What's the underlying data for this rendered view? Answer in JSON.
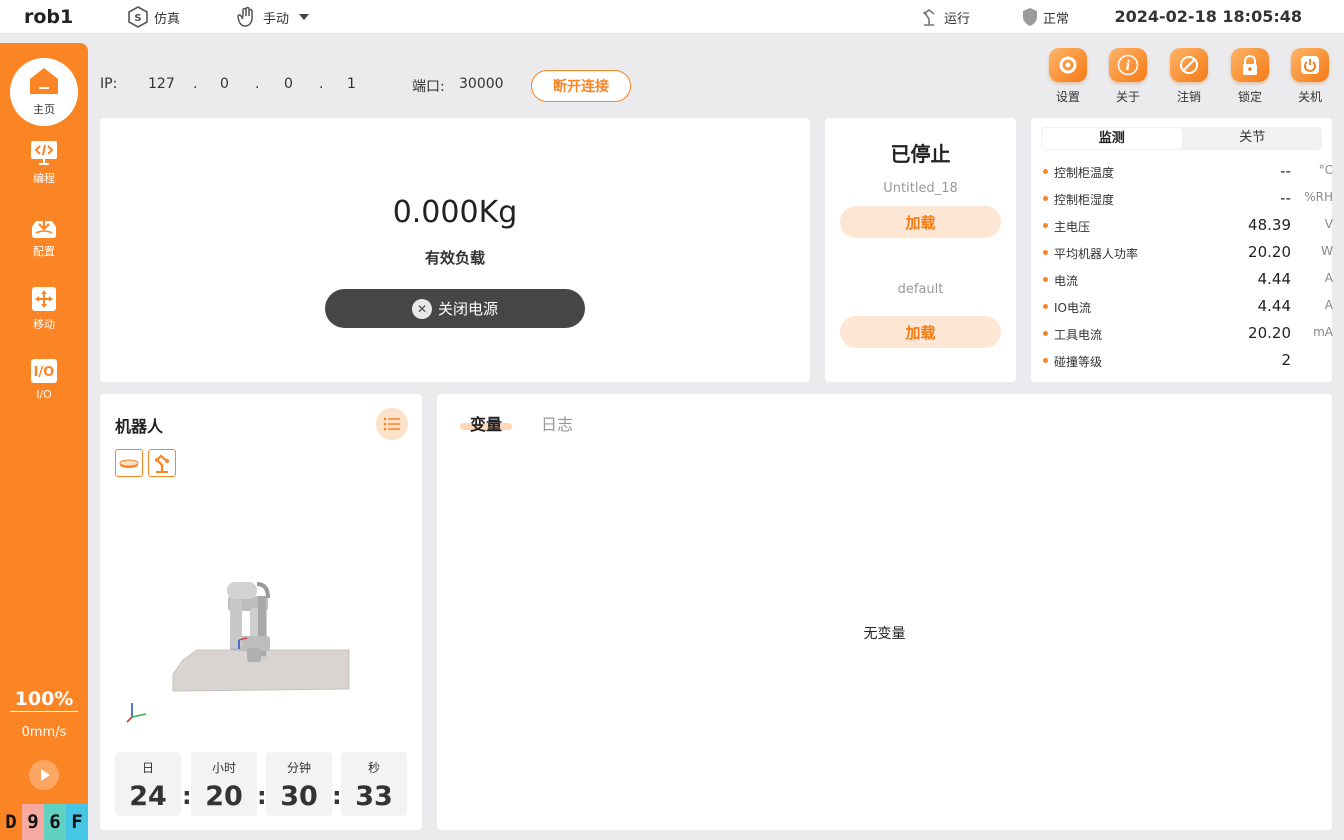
{
  "topbar": {
    "app_name": "rob1",
    "sim_mode": "仿真",
    "hand_mode": "手动",
    "run_state": "运行",
    "health": "正常",
    "datetime": "2024-02-18 18:05:48"
  },
  "sidebar": {
    "home": "主页",
    "items": [
      {
        "label": "编程",
        "icon": "code-icon"
      },
      {
        "label": "配置",
        "icon": "download-icon"
      },
      {
        "label": "移动",
        "icon": "move-icon"
      },
      {
        "label": "I/O",
        "icon": "io-icon"
      }
    ],
    "speed_percent": "100%",
    "speed_value": "0mm/s",
    "badges": [
      {
        "text": "D",
        "color": "#fb8425"
      },
      {
        "text": "9",
        "color": "#f6a9a0"
      },
      {
        "text": "6",
        "color": "#5fd1c0"
      },
      {
        "text": "F",
        "color": "#45c6e6"
      }
    ]
  },
  "connection": {
    "ip_label": "IP:",
    "ip": [
      "127",
      ".",
      "0",
      ".",
      "0",
      ".",
      "1"
    ],
    "port_label": "端口:",
    "port": "30000",
    "disconnect": "断开连接"
  },
  "toolbar": [
    {
      "label": "设置",
      "icon": "gear-icon"
    },
    {
      "label": "关于",
      "icon": "info-icon"
    },
    {
      "label": "注销",
      "icon": "logout-icon"
    },
    {
      "label": "锁定",
      "icon": "lock-icon"
    },
    {
      "label": "关机",
      "icon": "power-icon"
    }
  ],
  "payload": {
    "value": "0.000Kg",
    "label": "有效负载",
    "power_button": "关闭电源"
  },
  "program": {
    "state": "已停止",
    "program_name": "Untitled_18",
    "load1": "加载",
    "config_name": "default",
    "load2": "加载"
  },
  "monitor": {
    "tabs": [
      "监测",
      "关节"
    ],
    "rows": [
      {
        "name": "控制柜温度",
        "value": "--",
        "unit": "°C"
      },
      {
        "name": "控制柜湿度",
        "value": "--",
        "unit": "%RH"
      },
      {
        "name": "主电压",
        "value": "48.39",
        "unit": "V"
      },
      {
        "name": "平均机器人功率",
        "value": "20.20",
        "unit": "W"
      },
      {
        "name": "电流",
        "value": "4.44",
        "unit": "A"
      },
      {
        "name": "IO电流",
        "value": "4.44",
        "unit": "A"
      },
      {
        "name": "工具电流",
        "value": "20.20",
        "unit": "mA"
      },
      {
        "name": "碰撞等级",
        "value": "2",
        "unit": ""
      }
    ]
  },
  "robot": {
    "title": "机器人",
    "timer": [
      {
        "label": "日",
        "value": "24"
      },
      {
        "label": "小时",
        "value": "20"
      },
      {
        "label": "分钟",
        "value": "30"
      },
      {
        "label": "秒",
        "value": "33"
      }
    ],
    "sep": ":"
  },
  "vars": {
    "tabs": [
      "变量",
      "日志"
    ],
    "empty": "无变量"
  }
}
